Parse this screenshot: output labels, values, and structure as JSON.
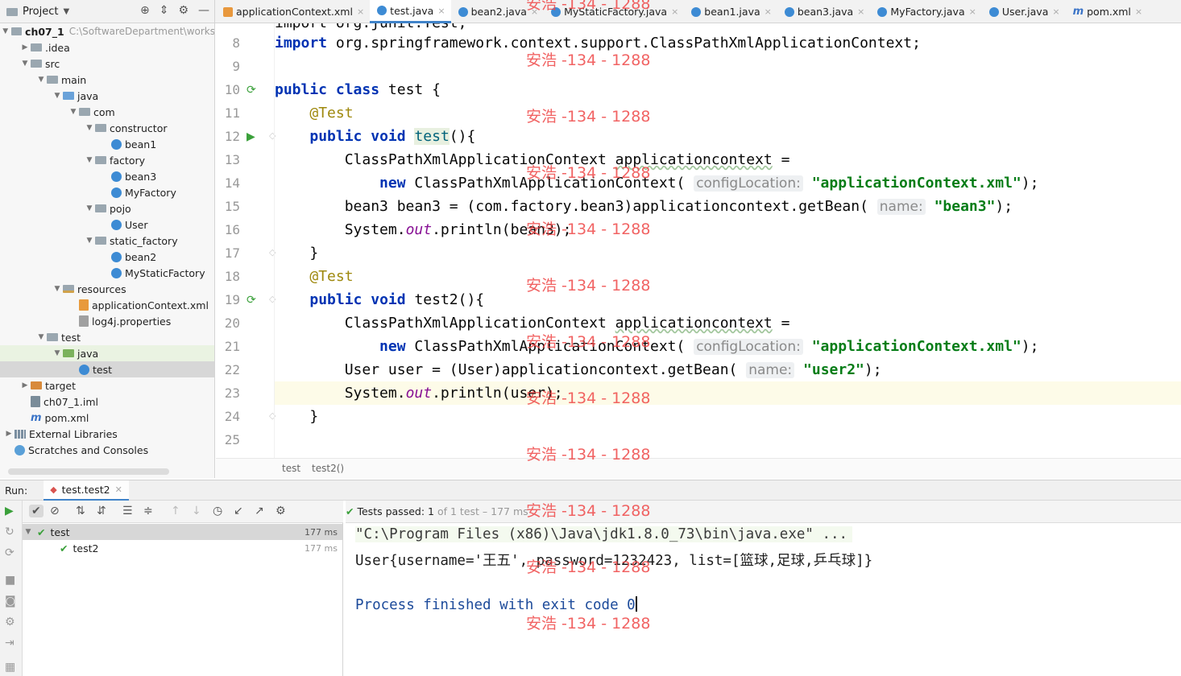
{
  "project_panel": {
    "title": "Project",
    "tools": [
      "target-icon",
      "collapse-icon",
      "gear-icon",
      "minimize-icon"
    ]
  },
  "tabs": [
    {
      "label": "applicationContext.xml",
      "icon": "xml-icon",
      "active": false
    },
    {
      "label": "test.java",
      "icon": "class-icon",
      "active": true
    },
    {
      "label": "bean2.java",
      "icon": "class-icon",
      "active": false
    },
    {
      "label": "MyStaticFactory.java",
      "icon": "class-icon",
      "active": false
    },
    {
      "label": "bean1.java",
      "icon": "class-icon",
      "active": false
    },
    {
      "label": "bean3.java",
      "icon": "class-icon",
      "active": false
    },
    {
      "label": "MyFactory.java",
      "icon": "class-icon",
      "active": false
    },
    {
      "label": "User.java",
      "icon": "class-icon",
      "active": false
    },
    {
      "label": "pom.xml",
      "icon": "maven-icon",
      "active": false
    }
  ],
  "tree": {
    "root": {
      "label": "ch07_1",
      "path": "C:\\SoftwareDepartment\\works"
    },
    "items": [
      {
        "label": ".idea",
        "depth": 1,
        "expanded": false
      },
      {
        "label": "src",
        "depth": 1,
        "expanded": true
      },
      {
        "label": "main",
        "depth": 2,
        "expanded": true
      },
      {
        "label": "java",
        "depth": 3,
        "expanded": true
      },
      {
        "label": "com",
        "depth": 4,
        "expanded": true
      },
      {
        "label": "constructor",
        "depth": 5,
        "expanded": true
      },
      {
        "label": "bean1",
        "depth": 6
      },
      {
        "label": "factory",
        "depth": 5,
        "expanded": true
      },
      {
        "label": "bean3",
        "depth": 6
      },
      {
        "label": "MyFactory",
        "depth": 6
      },
      {
        "label": "pojo",
        "depth": 5,
        "expanded": true
      },
      {
        "label": "User",
        "depth": 6
      },
      {
        "label": "static_factory",
        "depth": 5,
        "expanded": true
      },
      {
        "label": "bean2",
        "depth": 6
      },
      {
        "label": "MyStaticFactory",
        "depth": 6
      },
      {
        "label": "resources",
        "depth": 3,
        "expanded": true
      },
      {
        "label": "applicationContext.xml",
        "depth": 4
      },
      {
        "label": "log4j.properties",
        "depth": 4
      },
      {
        "label": "test",
        "depth": 2,
        "expanded": true
      },
      {
        "label": "java",
        "depth": 3,
        "expanded": true
      },
      {
        "label": "test",
        "depth": 4
      },
      {
        "label": "target",
        "depth": 1,
        "expanded": false
      },
      {
        "label": "ch07_1.iml",
        "depth": 1
      },
      {
        "label": "pom.xml",
        "depth": 1
      },
      {
        "label": "External Libraries",
        "depth": 0,
        "expanded": false
      },
      {
        "label": "Scratches and Consoles",
        "depth": 0
      }
    ]
  },
  "editor": {
    "line_numbers": [
      "8",
      "9",
      "10",
      "11",
      "12",
      "13",
      "14",
      "15",
      "16",
      "17",
      "18",
      "19",
      "20",
      "21",
      "22",
      "23",
      "24",
      "25"
    ],
    "top_partial": "import org.junit.Test;",
    "import_line": {
      "kw": "import",
      "rest": " org.springframework.context.support.ClassPathXmlApplicationContext;"
    },
    "class_decl": {
      "kw1": "public",
      "kw2": "class",
      "name": " test {"
    },
    "annotation": "@Test",
    "m1_decl": {
      "kw1": "public",
      "kw2": "void",
      "name": "test",
      "rest": "(){"
    },
    "ctx_decl": {
      "type": "ClassPathXmlApplicationContext ",
      "var": "applicationcontext",
      "rest": " ="
    },
    "new_ctx": {
      "kw": "new",
      "cls": " ClassPathXmlApplicationContext(",
      "hint": "configLocation:",
      "str": "\"applicationContext.xml\"",
      "end": ");"
    },
    "bean3_line": {
      "pre": "bean3 bean3 = (com.factory.bean3)applicationcontext.getBean(",
      "hint": "name:",
      "str": "\"bean3\"",
      "end": ");"
    },
    "print_bean3": {
      "pre": "System.",
      "fld": "out",
      "rest": ".println(bean3);"
    },
    "close_brace": "}",
    "m2_decl": {
      "kw1": "public",
      "kw2": "void",
      "name": "test2",
      "rest": "(){"
    },
    "user_line": {
      "pre": "User user = (User)applicationcontext.getBean(",
      "hint": "name:",
      "str": "\"user2\"",
      "end": ");"
    },
    "print_user": {
      "pre": "System.",
      "fld": "out",
      "rest": ".println(user);"
    },
    "breadcrumb": [
      "test",
      "test2()"
    ]
  },
  "run": {
    "label": "Run:",
    "tab": "test.test2",
    "status": {
      "prefix": "Tests passed:",
      "count": "1",
      "rest": "of 1 test – 177 ms"
    },
    "results": [
      {
        "name": "test",
        "time": "177 ms"
      },
      {
        "name": "test2",
        "time": "177 ms"
      }
    ],
    "console": [
      "\"C:\\Program Files (x86)\\Java\\jdk1.8.0_73\\bin\\java.exe\" ...",
      "User{username='王五', password=1232423, list=[篮球,足球,乒乓球]}",
      "",
      "Process finished with exit code 0"
    ]
  },
  "watermark": "安浩 -134 - 1288",
  "colors": {
    "keyword": "#0033b3",
    "string": "#067d17",
    "annotation": "#9e880d",
    "field": "#871094",
    "pass": "#3aa03a",
    "watermark": "#ee4848",
    "active_tab": "#4083c9"
  }
}
